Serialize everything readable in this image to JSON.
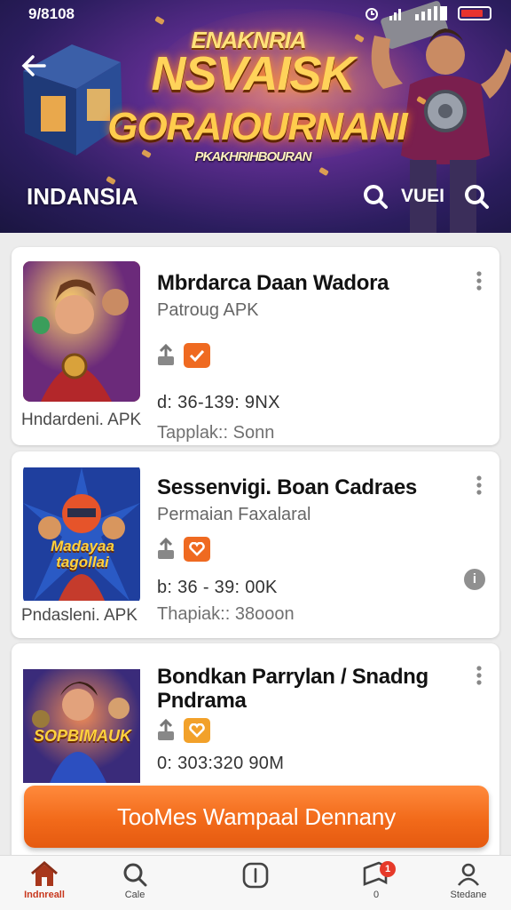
{
  "status_bar": {
    "time": "9/8108",
    "icons": [
      "alarm-icon",
      "signal-icon",
      "wifi-icon",
      "battery-icon"
    ]
  },
  "hero": {
    "title_line1": "ENAKNRIA",
    "title_line2": "NSVAISK",
    "title_line3": "GORAIOURNANI",
    "subtitle": "PKAKHRIHBOURAN",
    "region_label": "INDANSIA",
    "tab_label": "VUEI"
  },
  "apps": [
    {
      "title": "Mbrdarca Daan Wadora",
      "subtitle": "Patroug APK",
      "size": "d: 36-139: 9NX",
      "tags": "Tapplak:: Sonn",
      "platform": "Hndardeni. APK"
    },
    {
      "title": "Sessenvigi. Boan Cadraes",
      "subtitle": "Permaian Faxalaral",
      "size": "b:  36 - 39: 00K",
      "tags": "Thapiak:: 38ooon",
      "platform": "Pndasleni. APK",
      "thumb_text": "Madayaa tagollai",
      "info_icon": "i"
    },
    {
      "title": "Bondkan Parrylan / Snadng Pndrama",
      "size": "0: 303:320 90M",
      "thumb_text": "SOPBIMAUK"
    }
  ],
  "cta": {
    "label": "TooMes Wampaal Dennany"
  },
  "bottom_nav": [
    {
      "label": "Indnreall",
      "icon": "home-icon",
      "active": true
    },
    {
      "label": "Cale",
      "icon": "search-icon"
    },
    {
      "label": "",
      "icon": "info-square-icon"
    },
    {
      "label": "0",
      "icon": "flag-icon",
      "badge": "1"
    },
    {
      "label": "Stedane",
      "icon": "profile-icon"
    }
  ],
  "colors": {
    "accent": "#f26a1a",
    "badge_red": "#e63a2a",
    "nav_active": "#c8371d",
    "hero_bg": "#2b1d5e"
  }
}
